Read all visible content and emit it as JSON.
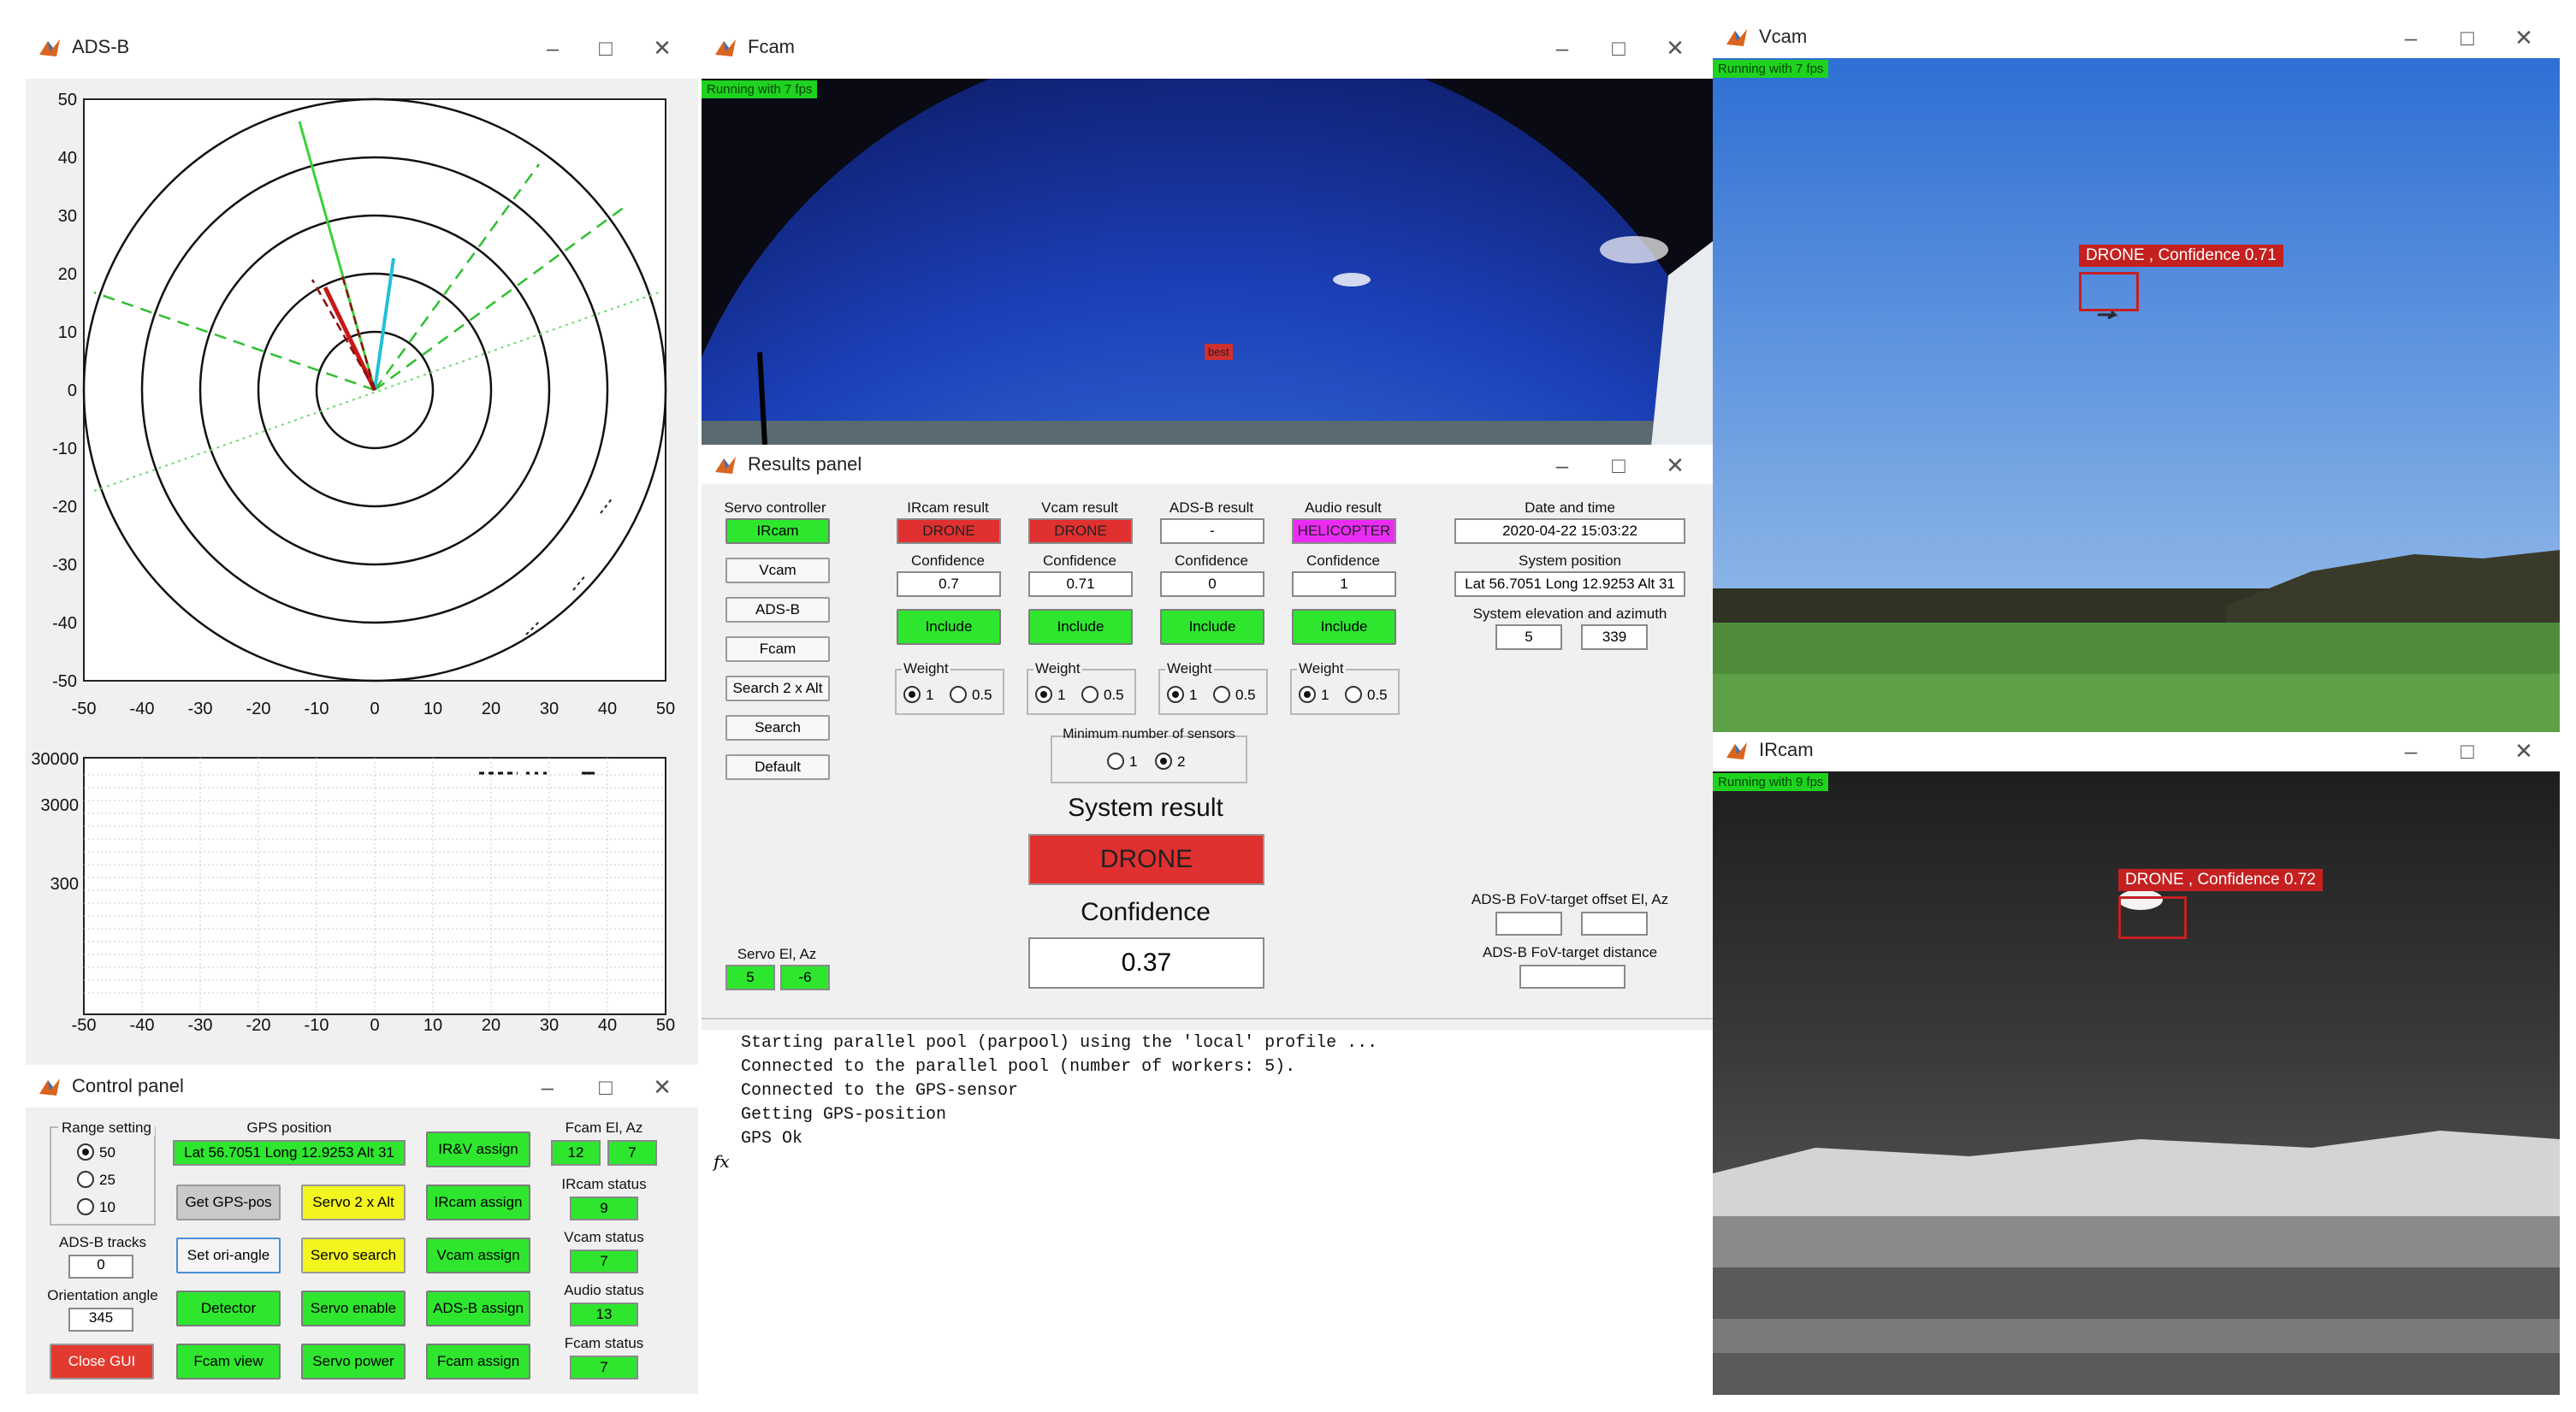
{
  "windows": {
    "adsb": {
      "title": "ADS-B"
    },
    "fcam": {
      "title": "Fcam",
      "fps": "Running with 7 fps",
      "marker": "best"
    },
    "vcam": {
      "title": "Vcam",
      "fps": "Running with 7 fps",
      "detection": "DRONE , Confidence 0.71"
    },
    "ircam": {
      "title": "IRcam",
      "fps": "Running with 9 fps",
      "detection": "DRONE , Confidence 0.72"
    },
    "results": {
      "title": "Results panel"
    },
    "control": {
      "title": "Control panel"
    }
  },
  "polar_plot": {
    "x_ticks": [
      "-50",
      "-40",
      "-30",
      "-20",
      "-10",
      "0",
      "10",
      "20",
      "30",
      "40",
      "50"
    ],
    "y_ticks": [
      "50",
      "40",
      "30",
      "20",
      "10",
      "0",
      "-10",
      "-20",
      "-30",
      "-40",
      "-50"
    ]
  },
  "alt_plot": {
    "y_ticks": [
      "30000",
      "3000",
      "300"
    ],
    "x_ticks": [
      "-50",
      "-40",
      "-30",
      "-20",
      "-10",
      "0",
      "10",
      "20",
      "30",
      "40",
      "50"
    ]
  },
  "results": {
    "servo_controller": {
      "label": "Servo controller",
      "buttons": [
        "IRcam",
        "Vcam",
        "ADS-B",
        "Fcam",
        "Search 2 x Alt",
        "Search",
        "Default"
      ]
    },
    "columns": [
      {
        "header": "IRcam result",
        "result": "DRONE",
        "conf_label": "Confidence",
        "conf": "0.7",
        "include": "Include",
        "weight_label": "Weight",
        "w1": "1",
        "w2": "0.5"
      },
      {
        "header": "Vcam result",
        "result": "DRONE",
        "conf_label": "Confidence",
        "conf": "0.71",
        "include": "Include",
        "weight_label": "Weight",
        "w1": "1",
        "w2": "0.5"
      },
      {
        "header": "ADS-B result",
        "result": "-",
        "conf_label": "Confidence",
        "conf": "0",
        "include": "Include",
        "weight_label": "Weight",
        "w1": "1",
        "w2": "0.5"
      },
      {
        "header": "Audio result",
        "result": "HELICOPTER",
        "conf_label": "Confidence",
        "conf": "1",
        "include": "Include",
        "weight_label": "Weight",
        "w1": "1",
        "w2": "0.5"
      }
    ],
    "date_label": "Date and time",
    "date_value": "2020-04-22    15:03:22",
    "syspos_label": "System position",
    "syspos_value": "Lat 56.7051 Long 12.9253 Alt 31",
    "elaz_label": "System elevation and azimuth",
    "el": "5",
    "az": "339",
    "min_sensors_label": "Minimum number of sensors",
    "min1": "1",
    "min2": "2",
    "system_result_label": "System result",
    "system_result": "DRONE",
    "confidence_label": "Confidence",
    "confidence": "0.37",
    "servo_elaz_label": "Servo El, Az",
    "servo_el": "5",
    "servo_az": "-6",
    "fov_offset_label": "ADS-B FoV-target offset El, Az",
    "fov_distance_label": "ADS-B FoV-target distance"
  },
  "console": {
    "lines": [
      "Starting parallel pool (parpool) using the 'local' profile ...",
      "Connected to the parallel pool (number of workers: 5).",
      "Connected to the GPS-sensor",
      "Getting GPS-position",
      "GPS Ok"
    ],
    "fx": "fx"
  },
  "control": {
    "range_label": "Range setting",
    "range_options": [
      "50",
      "25",
      "10"
    ],
    "adsb_tracks_label": "ADS-B tracks",
    "adsb_tracks": "0",
    "orientation_label": "Orientation angle",
    "orientation": "345",
    "close": "Close GUI",
    "gps_label": "GPS position",
    "gps_value": "Lat 56.7051 Long 12.9253 Alt 31",
    "get_gps": "Get GPS-pos",
    "set_ori": "Set ori-angle",
    "detector": "Detector",
    "fcam_view": "Fcam view",
    "servo2alt": "Servo 2 x Alt",
    "servo_search": "Servo search",
    "servo_enable": "Servo enable",
    "servo_power": "Servo power",
    "irv_assign": "IR&V assign",
    "ircam_assign": "IRcam assign",
    "vcam_assign": "Vcam assign",
    "adsb_assign": "ADS-B assign",
    "fcam_assign": "Fcam assign",
    "fcam_elaz_label": "Fcam El, Az",
    "fcam_el": "12",
    "fcam_az": "7",
    "ircam_status_label": "IRcam status",
    "ircam_status": "9",
    "vcam_status_label": "Vcam status",
    "vcam_status": "7",
    "audio_status_label": "Audio status",
    "audio_status": "13",
    "fcam_status_label": "Fcam status",
    "fcam_status": "7"
  },
  "colors": {
    "green": "#2fe62f",
    "red": "#e03030",
    "yellow": "#f3f51f",
    "magenta": "#ea2cf2"
  }
}
